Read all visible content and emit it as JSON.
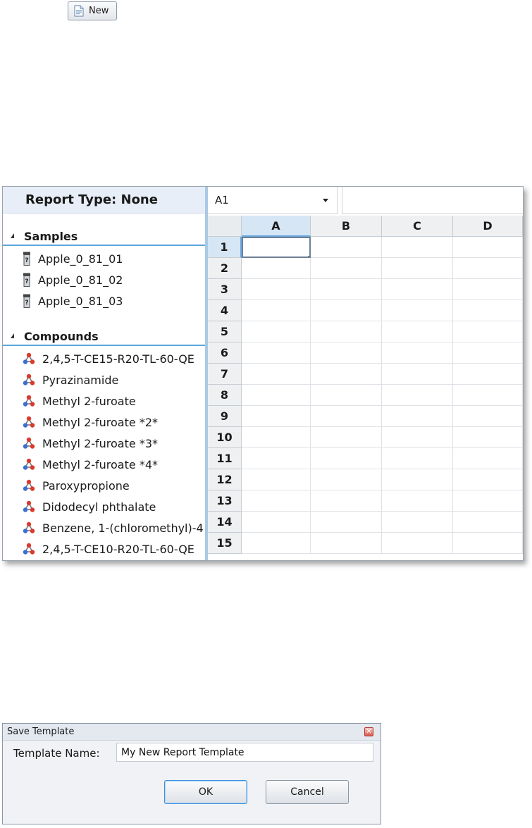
{
  "toolbar": {
    "new_label": "New"
  },
  "report_panel": {
    "report_type_label": "Report Type: None",
    "samples": {
      "header": "Samples",
      "items": [
        "Apple_0_81_01",
        "Apple_0_81_02",
        "Apple_0_81_03"
      ]
    },
    "compounds": {
      "header": "Compounds",
      "items": [
        "2,4,5-T-CE15-R20-TL-60-QE",
        "Pyrazinamide",
        "Methyl 2-furoate",
        "Methyl 2-furoate *2*",
        "Methyl 2-furoate *3*",
        "Methyl 2-furoate *4*",
        "Paroxypropione",
        "Didodecyl phthalate",
        "Benzene, 1-(chloromethyl)-4",
        "2,4,5-T-CE10-R20-TL-60-QE"
      ]
    }
  },
  "spreadsheet": {
    "name_box": "A1",
    "columns": [
      "A",
      "B",
      "C",
      "D"
    ],
    "rows": [
      "1",
      "2",
      "3",
      "4",
      "5",
      "6",
      "7",
      "8",
      "9",
      "10",
      "11",
      "12",
      "13",
      "14",
      "15"
    ],
    "active_cell": "A1"
  },
  "save_dialog": {
    "title": "Save Template",
    "name_label": "Template Name:",
    "name_value": "My New Report Template",
    "ok_label": "OK",
    "cancel_label": "Cancel"
  },
  "colors": {
    "accent_blue": "#5ba7dc",
    "header_bg": "#e8eef8",
    "active_header": "#d6e6f5"
  }
}
